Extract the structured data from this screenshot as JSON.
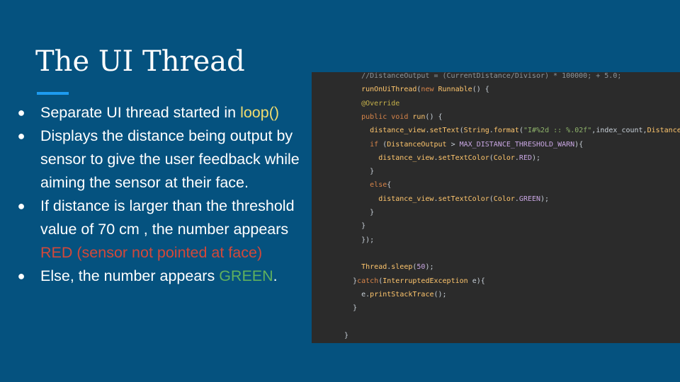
{
  "slide": {
    "title": "The UI Thread",
    "bullets": [
      {
        "bullet": "●",
        "parts": [
          {
            "text": "Separate UI thread started in ",
            "style": "plain"
          },
          {
            "text": "loop()",
            "style": "yellow"
          }
        ]
      },
      {
        "bullet": "●",
        "parts": [
          {
            "text": "Displays the distance being output by sensor to give the user feedback while aiming the sensor at their face.",
            "style": "plain"
          }
        ]
      },
      {
        "bullet": "●",
        "parts": [
          {
            "text": "If distance is larger than the threshold value of 70 cm , the number appears ",
            "style": "plain"
          },
          {
            "text": "RED (sensor not pointed at face)",
            "style": "red"
          }
        ]
      },
      {
        "bullet": "●",
        "parts": [
          {
            "text": "Else, the number appears ",
            "style": "plain"
          },
          {
            "text": "GREEN",
            "style": "green"
          },
          {
            "text": ".",
            "style": "plain"
          }
        ]
      }
    ]
  },
  "code": {
    "lines": [
      {
        "indent": 6,
        "tokens": [
          {
            "t": "//DistanceOutput = (CurrentDistance/Divisor) * 100000; + 5.0;",
            "s": "faded"
          }
        ]
      },
      {
        "indent": 6,
        "tokens": [
          {
            "t": "runOnUiThread",
            "s": "call"
          },
          {
            "t": "(",
            "s": "plain"
          },
          {
            "t": "new ",
            "s": "kw"
          },
          {
            "t": "Runnable",
            "s": "call"
          },
          {
            "t": "() {",
            "s": "plain"
          }
        ]
      },
      {
        "indent": 6,
        "tokens": [
          {
            "t": "@Override",
            "s": "ann"
          }
        ]
      },
      {
        "indent": 6,
        "tokens": [
          {
            "t": "public void ",
            "s": "kw"
          },
          {
            "t": "run",
            "s": "call"
          },
          {
            "t": "() {",
            "s": "plain"
          }
        ]
      },
      {
        "indent": 8,
        "tokens": [
          {
            "t": "distance_view",
            "s": "call"
          },
          {
            "t": ".",
            "s": "plain"
          },
          {
            "t": "setText",
            "s": "call"
          },
          {
            "t": "(",
            "s": "plain"
          },
          {
            "t": "String",
            "s": "call"
          },
          {
            "t": ".",
            "s": "plain"
          },
          {
            "t": "format",
            "s": "call"
          },
          {
            "t": "(",
            "s": "plain"
          },
          {
            "t": "\"I#%2d :: %.02f\"",
            "s": "str"
          },
          {
            "t": ",index_count,",
            "s": "plain"
          },
          {
            "t": "DistanceOutput",
            "s": "call"
          },
          {
            "t": "));",
            "s": "plain"
          }
        ]
      },
      {
        "indent": 8,
        "tokens": [
          {
            "t": "if ",
            "s": "kw"
          },
          {
            "t": "(",
            "s": "plain"
          },
          {
            "t": "DistanceOutput",
            "s": "call"
          },
          {
            "t": " > ",
            "s": "plain"
          },
          {
            "t": "MAX_DISTANCE_THRESHOLD_WARN",
            "s": "const"
          },
          {
            "t": "){",
            "s": "plain"
          }
        ]
      },
      {
        "indent": 10,
        "tokens": [
          {
            "t": "distance_view",
            "s": "call"
          },
          {
            "t": ".",
            "s": "plain"
          },
          {
            "t": "setTextColor",
            "s": "call"
          },
          {
            "t": "(",
            "s": "plain"
          },
          {
            "t": "Color",
            "s": "call"
          },
          {
            "t": ".",
            "s": "plain"
          },
          {
            "t": "RED",
            "s": "const"
          },
          {
            "t": ");",
            "s": "plain"
          }
        ]
      },
      {
        "indent": 8,
        "tokens": [
          {
            "t": "}",
            "s": "plain"
          }
        ]
      },
      {
        "indent": 8,
        "tokens": [
          {
            "t": "else",
            "s": "kw"
          },
          {
            "t": "{",
            "s": "plain"
          }
        ]
      },
      {
        "indent": 10,
        "tokens": [
          {
            "t": "distance_view",
            "s": "call"
          },
          {
            "t": ".",
            "s": "plain"
          },
          {
            "t": "setTextColor",
            "s": "call"
          },
          {
            "t": "(",
            "s": "plain"
          },
          {
            "t": "Color",
            "s": "call"
          },
          {
            "t": ".",
            "s": "plain"
          },
          {
            "t": "GREEN",
            "s": "const"
          },
          {
            "t": ");",
            "s": "plain"
          }
        ]
      },
      {
        "indent": 8,
        "tokens": [
          {
            "t": "}",
            "s": "plain"
          }
        ]
      },
      {
        "indent": 6,
        "tokens": [
          {
            "t": "}",
            "s": "plain"
          }
        ]
      },
      {
        "indent": 6,
        "tokens": [
          {
            "t": "});",
            "s": "plain"
          }
        ]
      },
      {
        "indent": 0,
        "tokens": []
      },
      {
        "indent": 6,
        "tokens": [
          {
            "t": "Thread",
            "s": "call"
          },
          {
            "t": ".",
            "s": "plain"
          },
          {
            "t": "sleep",
            "s": "call"
          },
          {
            "t": "(",
            "s": "plain"
          },
          {
            "t": "50",
            "s": "const"
          },
          {
            "t": ");",
            "s": "plain"
          }
        ]
      },
      {
        "indent": 4,
        "tokens": [
          {
            "t": "}",
            "s": "plain"
          },
          {
            "t": "catch",
            "s": "kw"
          },
          {
            "t": "(",
            "s": "plain"
          },
          {
            "t": "InterruptedException",
            "s": "call"
          },
          {
            "t": " e){",
            "s": "plain"
          }
        ]
      },
      {
        "indent": 6,
        "tokens": [
          {
            "t": "e",
            "s": "plain"
          },
          {
            "t": ".",
            "s": "plain"
          },
          {
            "t": "printStackTrace",
            "s": "call"
          },
          {
            "t": "();",
            "s": "plain"
          }
        ]
      },
      {
        "indent": 4,
        "tokens": [
          {
            "t": "}",
            "s": "plain"
          }
        ]
      },
      {
        "indent": 0,
        "tokens": []
      },
      {
        "indent": 2,
        "tokens": [
          {
            "t": "}",
            "s": "plain"
          }
        ]
      }
    ]
  },
  "colors": {
    "background": "#05527f",
    "accent_underline": "#1d9bf0",
    "code_background": "#2b2b2b",
    "yellow": "#f2dc6e",
    "red": "#d2483a",
    "green": "#5fb05e"
  }
}
